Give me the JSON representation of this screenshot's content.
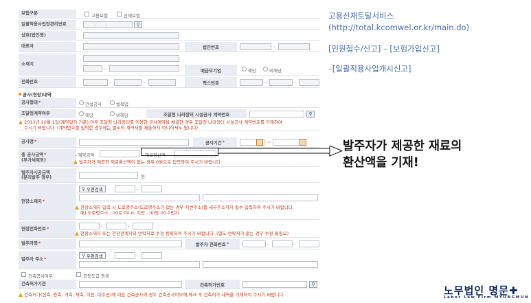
{
  "form": {
    "insurance_type": {
      "label": "보험구분",
      "opt1": "고용보험",
      "opt2": "산재보험"
    },
    "mgmt_no": {
      "label": "일괄적용사업장관리번호",
      "dash1": "-",
      "dash2": "-",
      "search_icon": "search-icon"
    },
    "company_name": {
      "label": "상호(법인명)"
    },
    "ceo": {
      "label": "대표자",
      "reg_label": "법인번호",
      "dash": "-"
    },
    "address": {
      "label": "소재지",
      "dash": "-",
      "sme_label": "매급모기업",
      "sme_opt1": "해당",
      "sme_opt2": "비해당"
    },
    "phone": {
      "label": "전화번호",
      "dash1": "-",
      "dash2": "-",
      "fax_label": "팩스번호",
      "fax_dash1": "-",
      "fax_dash2": "-"
    },
    "section_title": "공사(현장)내역",
    "construction_type": {
      "label": "공사형태",
      "opt1": "건설공사",
      "opt2": "벌목업"
    },
    "procurement": {
      "label": "조달청계약여부",
      "opt1": "해당",
      "opt2": "비해당",
      "market_label": "조달청 나라장터 시설공사 계약번호",
      "warn1": "2013년 10월 1일(계약일자 기준) 이후 조달청 나라장터를 이용한 공사계약을 체결한 경우 조달청 나라장터 시설공사 계약번호를 기재하여",
      "warn2": "주시기 바랍니다. (계약번호를 입력한 경우에는 별도의 계약서를 제출하지 아니하셔도 됩니다)"
    },
    "project_name": {
      "label": "공사명",
      "period_label": "공사기간",
      "tilde": "~"
    },
    "amount": {
      "label1": "총 공사금액",
      "label2": "(부가세제외)",
      "contract_label": "- 계약금액",
      "material_label": "재료환산액",
      "warn": "발주자가 제공한 재료환산액이 없는 경우 0원으로 입력하여 주시기 바랍니다."
    },
    "client_exec": {
      "label1": "발주자시공금액",
      "label2": "(분리발주 경우)",
      "won": "원"
    },
    "site_address": {
      "label": "현장소재지",
      "postal_btn": "우편검색",
      "dash": "-",
      "warn1": "현장소재지 입력 시 도로명주소(도로명주소가 없는 경우 지번주소)를 세부주소까지 필수 입력하여 주시기 바랍니다.",
      "warn2": "예) 도로명주소 : 00로 00-0, 지번 : 00동 00-0번지"
    },
    "site_phone": {
      "label": "현장전화번호",
      "dash1": "-",
      "dash2": "-",
      "warn": "현장소재지 또는 현장관계자의 연락처로 수정 등록하여 주시기 바랍니다. (별도 연락처가 없는 경우 수정 불필요)"
    },
    "client_name": {
      "label": "발주자명",
      "phone_label": "발주자 전화번호",
      "dash1": "-",
      "dash2": "-"
    },
    "client_address": {
      "label": "발주자 주소",
      "postal_btn": "우편검색",
      "dash": "-"
    },
    "building": {
      "opt1": "건축공사여부",
      "opt2": "공동도급 등록"
    },
    "permit": {
      "label": "건축허가기관",
      "no_label": "건축허가번호"
    },
    "bottom_warn": "건축허가(신축, 증축, 개축, 재축, 이전, 대수선)에 따른 건축공사의 경우 건축공사여부에 체크 후 건축허가 내역을 기재하여 주시기 바랍니다."
  },
  "right": {
    "line1": "고용산재토탈서비스",
    "line2": "(http://total.kcomwel.or.kr/main.do)",
    "line3": "[민원접수/신고] – [보험가입신고]",
    "line4": "–[일괄적용사업개시신고]",
    "callout1": "발주자가 제공한 재료의",
    "callout2": "환산액을 기재!",
    "logo_main": "노무법인 명문✚",
    "logo_sub": "Labor Law Firm MYUNGMUN"
  },
  "colors": {
    "label_bg": "#e9edf3",
    "warn": "#c23a1e",
    "info": "#4a6fa8",
    "logo": "#0c2a5a"
  }
}
